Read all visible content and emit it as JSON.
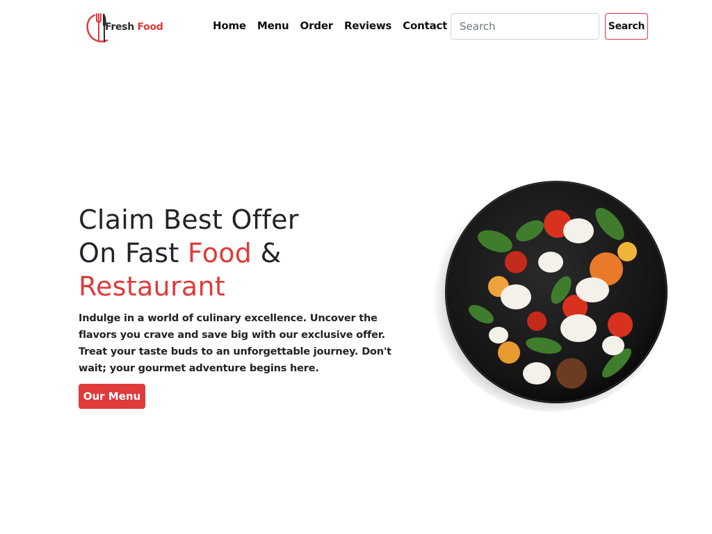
{
  "brand": {
    "name_part1": "Fresh",
    "name_part2": "Food"
  },
  "nav": {
    "items": [
      {
        "label": "Home"
      },
      {
        "label": "Menu"
      },
      {
        "label": "Order"
      },
      {
        "label": "Reviews"
      },
      {
        "label": "Contact"
      }
    ]
  },
  "search": {
    "placeholder": "Search",
    "value": "",
    "button_label": "Search"
  },
  "hero": {
    "title_line1": "Claim Best Offer",
    "title_line2_a": "On Fast ",
    "title_line2_accent": "Food",
    "title_line2_b": " &",
    "title_line3_accent": "Restaurant",
    "description": "Indulge in a world of culinary excellence. Uncover the flavors you crave and save big with our exclusive offer. Treat your taste buds to an unforgettable journey. Don't wait; your gourmet adventure begins here.",
    "cta_label": "Our Menu"
  },
  "colors": {
    "accent": "#e03a3a",
    "text": "#212529",
    "plate": "#1a1a1a"
  },
  "icons": {
    "logo": "fork-knife-logo-icon",
    "hero": "salad-plate-image"
  }
}
